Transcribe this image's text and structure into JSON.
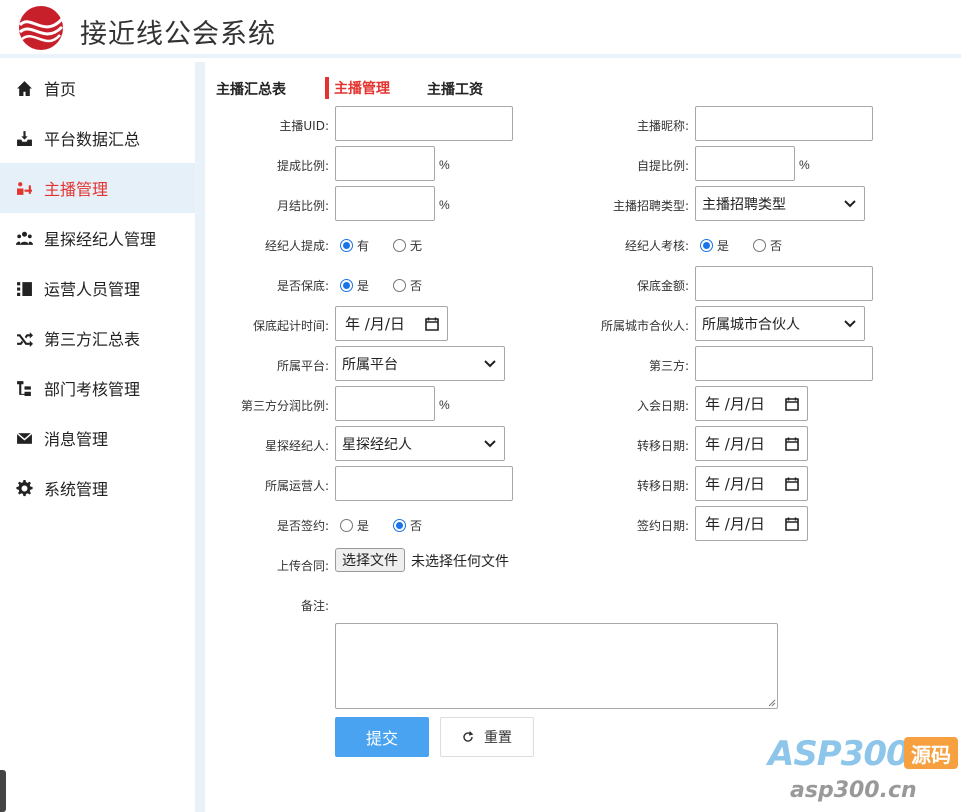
{
  "app": {
    "title": "接近线公会系统"
  },
  "sidebar": {
    "items": [
      {
        "label": "首页",
        "icon": "home-icon"
      },
      {
        "label": "平台数据汇总",
        "icon": "inbox-download-icon"
      },
      {
        "label": "主播管理",
        "icon": "broadcaster-icon",
        "active": true
      },
      {
        "label": "星探经纪人管理",
        "icon": "users-icon"
      },
      {
        "label": "运营人员管理",
        "icon": "contact-list-icon"
      },
      {
        "label": "第三方汇总表",
        "icon": "shuffle-icon"
      },
      {
        "label": "部门考核管理",
        "icon": "org-chart-icon"
      },
      {
        "label": "消息管理",
        "icon": "envelope-icon"
      },
      {
        "label": "系统管理",
        "icon": "gear-icon"
      }
    ]
  },
  "tabs": [
    {
      "label": "主播汇总表"
    },
    {
      "label": "主播管理",
      "active": true
    },
    {
      "label": "主播工资"
    }
  ],
  "form": {
    "uid_label": "主播UID:",
    "nickname_label": "主播昵称:",
    "commission_label": "提成比例:",
    "self_commission_label": "自提比例:",
    "monthly_label": "月结比例:",
    "recruit_type_label": "主播招聘类型:",
    "recruit_type_value": "主播招聘类型",
    "agent_commission_label": "经纪人提成:",
    "agent_commission_options": [
      "有",
      "无"
    ],
    "agent_review_label": "经纪人考核:",
    "agent_review_options": [
      "是",
      "否"
    ],
    "guarantee_label": "是否保底:",
    "guarantee_options": [
      "是",
      "否"
    ],
    "guarantee_amount_label": "保底金额:",
    "guarantee_start_label": "保底起计时间:",
    "city_partner_label": "所属城市合伙人:",
    "city_partner_value": "所属城市合伙人",
    "platform_label": "所属平台:",
    "platform_value": "所属平台",
    "third_party_label": "第三方:",
    "third_split_label": "第三方分润比例:",
    "join_date_label": "入会日期:",
    "scout_label": "星探经纪人:",
    "scout_value": "星探经纪人",
    "transfer_date_label_1": "转移日期:",
    "operator_label": "所属运营人:",
    "transfer_date_label_2": "转移日期:",
    "signed_label": "是否签约:",
    "signed_options": [
      "是",
      "否"
    ],
    "sign_date_label": "签约日期:",
    "upload_label": "上传合同:",
    "file_button": "选择文件",
    "file_status": "未选择任何文件",
    "remark_label": "备注:",
    "percent": "%",
    "date_placeholder": "年 /月/日",
    "submit": "提交",
    "reset": "重置"
  },
  "watermark": {
    "brand": "ASP300",
    "badge": "源码",
    "url": "asp300.cn"
  }
}
